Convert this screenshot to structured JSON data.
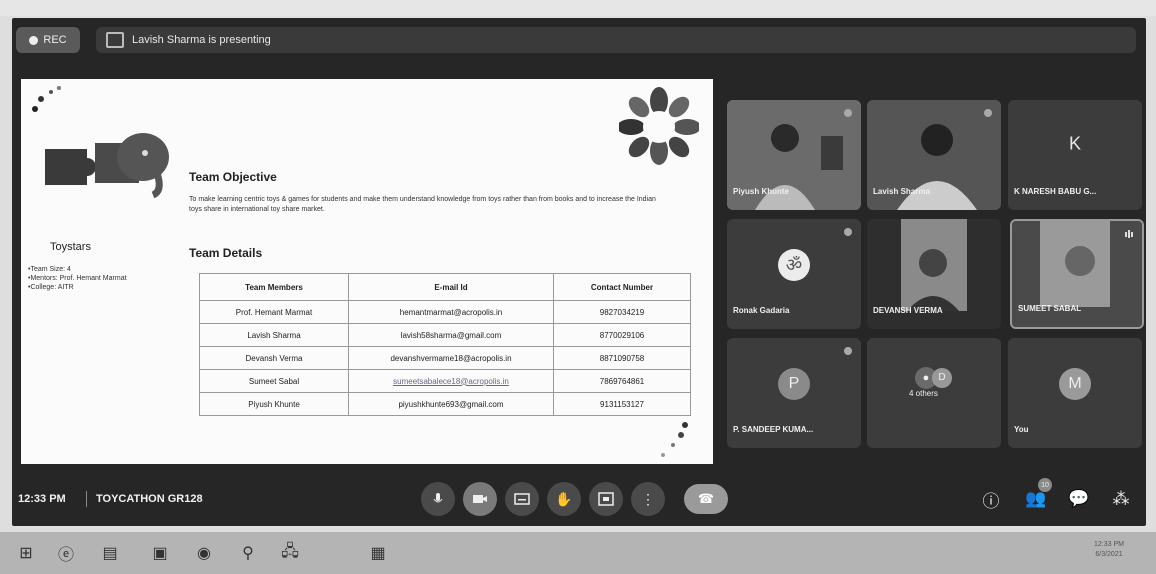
{
  "top_strip": {
    "text": "",
    "right_label": ""
  },
  "meet": {
    "rec_label": "REC",
    "presenting_text": "Lavish Sharma is presenting",
    "time": "12:33 PM",
    "meeting_code": "TOYCATHON GR128",
    "participants_badge": "10"
  },
  "slide": {
    "objective_title": "Team Objective",
    "objective_desc": "To make learning centric toys & games for students and make them understand knowledge from toys rather than from books and to increase the Indian toys share in international toy share market.",
    "team_name": "Toystars",
    "team_info": [
      "•Team Size: 4",
      "•Mentors: Prof. Hemant Marmat",
      "•College: AITR"
    ],
    "details_title": "Team Details",
    "table": {
      "headers": [
        "Team Members",
        "E-mail Id",
        "Contact Number"
      ],
      "rows": [
        [
          "Prof. Hemant Marmat",
          "hemantmarmat@acropolis.in",
          "9827034219"
        ],
        [
          "Lavish Sharma",
          "lavish58sharma@gmail.com",
          "8770029106"
        ],
        [
          "Devansh Verma",
          "devanshvermame18@acropolis.in",
          "8871090758"
        ],
        [
          "Sumeet Sabal",
          "sumeetsabalece18@acropolis.in",
          "7869764861"
        ],
        [
          "Piyush Khunte",
          "piyushkhunte693@gmail.com",
          "9131153127"
        ]
      ]
    }
  },
  "tiles": [
    {
      "name": "Piyush Khunte",
      "type": "video"
    },
    {
      "name": "Lavish Sharma",
      "type": "video"
    },
    {
      "name": "K NARESH BABU G...",
      "type": "letter",
      "letter": "K"
    },
    {
      "name": "Ronak Gadaria",
      "type": "om"
    },
    {
      "name": "DEVANSH VERMA",
      "type": "video"
    },
    {
      "name": "SUMEET SABAL",
      "type": "video"
    },
    {
      "name": "P. SANDEEP KUMA...",
      "type": "circle",
      "letter": "P"
    },
    {
      "name": "4 others",
      "type": "others",
      "letter": "D"
    },
    {
      "name": "You",
      "type": "circle",
      "letter": "M"
    }
  ],
  "taskbar": {
    "clock_time": "12:33 PM",
    "clock_date": "6/3/2021"
  }
}
